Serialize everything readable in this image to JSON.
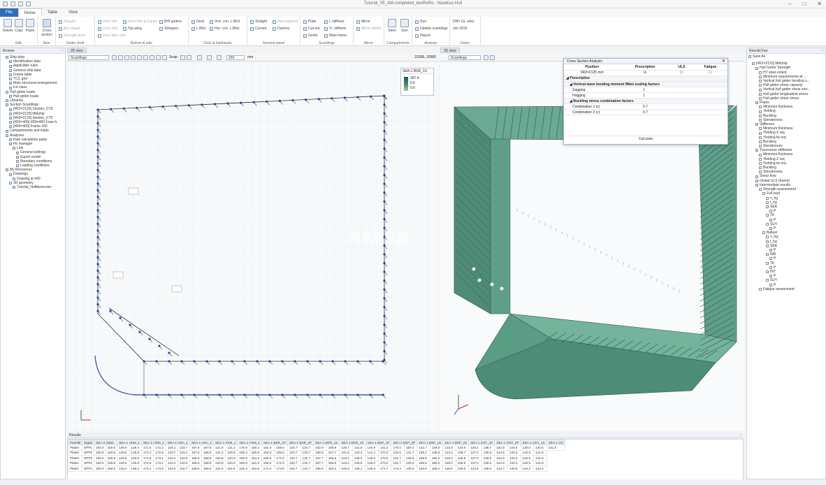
{
  "window": {
    "title": "Tutorial_05_AM.completed_testRoRo - Nauticus Hull"
  },
  "tabs": [
    "File",
    "Home",
    "Table",
    "View"
  ],
  "ribbon": {
    "edit_group": {
      "label": "Edit",
      "buttons": [
        "Delete",
        "Copy",
        "Paste"
      ]
    },
    "new_group": {
      "label": "New",
      "button": "Cross section"
    },
    "girder_shelf": {
      "label": "Girder shelf",
      "items": [
        "Straight",
        "Any shape",
        "Strength deck"
      ]
    },
    "bottom_side": {
      "label": "Bottom & side",
      "items": [
        "Inner btm",
        "Inner side",
        "Inner btm, side",
        "Inner btm & hopper",
        "Top wing",
        "BHI girders",
        "Stringers"
      ]
    },
    "deck_bulkheads": {
      "label": "Deck & bulkheads",
      "items": [
        "Deck",
        "L.Bhd.",
        "Vert. corr. L.Bhd.",
        "Hor. corr. L.Bhd."
      ]
    },
    "general_panel": {
      "label": "General panel",
      "items": [
        "Straight",
        "Curved",
        "Add segment",
        "Dummy"
      ]
    },
    "scantlings": {
      "label": "Scantlings",
      "items": [
        "Plate",
        "Cut-out",
        "Girder",
        "L.stiffener",
        "Tr. stiffener",
        "Main frame"
      ]
    },
    "mirror": {
      "label": "Mirror",
      "items": [
        "Mirror",
        "Mirror model"
      ]
    },
    "compartments": {
      "label": "Compartments",
      "items": [
        "Steel",
        "Gen"
      ]
    },
    "analysis": {
      "label": "Analysis",
      "items": [
        "Run",
        "Update scantlings",
        "Report"
      ]
    },
    "rules": {
      "label": "Rules",
      "items": [
        "DNV GL rules",
        "Jan 2016"
      ]
    }
  },
  "browse": {
    "title": "Browse",
    "items": [
      "Ship data",
      "Identification data",
      "Applicable rules",
      "General ship data",
      "Frame table",
      "TCC grid",
      "Main structural arrangement",
      "Ice class",
      "Hull girder loads",
      "Hull girder loads",
      "Libraries",
      "Section Scantlings",
      "[#R2=2125] Section_CTE",
      "[#R2=2125] Midship",
      "[#R0=2125] Section_CT5",
      "[#R0=400] #R0=400 Fram h.",
      "[#R0=400] Frame #60",
      "Compartments and loads",
      "Analyses",
      "Rule calculation tasks",
      "FE manager",
      "Link",
      "General settings",
      "Export model",
      "Boundary conditions",
      "Loading conditions",
      "My Resources",
      "Drawings",
      "Drawing at #60",
      "3D geometry",
      "Tutorial_Huffdemo.ber"
    ]
  },
  "view2d": {
    "tab": "Scantlings",
    "tab2": "2D view",
    "mode": "Scantlings",
    "snap": "Snap",
    "zoom": "150",
    "unit": "mm",
    "coords": "23285, 20580",
    "legend_title": "SEA-1 BSR_1S",
    "legend_values": [
      "187.4",
      "0.0",
      "0.0"
    ]
  },
  "view3d": {
    "tab": "3D view",
    "mode": "Scantlings"
  },
  "csa": {
    "title": "Cross Section Analysis",
    "col_headers": [
      "Position",
      "Prescriptive",
      "ULS",
      "Fatigue"
    ],
    "position": "#R2=2125 mm",
    "section_prescriptive": "Prescriptive",
    "sub1": "Vertical wave bending moment fMwv scaling factors",
    "rows1": [
      {
        "label": "Sagging",
        "value": "1"
      },
      {
        "label": "Hogging",
        "value": "1"
      }
    ],
    "sub2": "Buckling stress combination factors",
    "rows2": [
      {
        "label": "Combination 1 (c)",
        "value": "0.7"
      },
      {
        "label": "Combination 2 (c)",
        "value": "0.7"
      }
    ],
    "calculate": "Calculate"
  },
  "results_tree": {
    "title": "ResultsTree",
    "save_as": "Save As",
    "items": [
      "[#R2=2125] Midship",
      "Hull Girder Strength",
      "HT steel extent",
      "Minimum requirements at ...",
      "Vertical hull girder bending s...",
      "Hull girder shear capacity",
      "Vertical hull girder shear stre...",
      "Hull girder longitudinal stress",
      "Hull girder shear stress",
      "Plates",
      "Minimum thickness",
      "Yielding",
      "Buckling",
      "Slenderness",
      "Stiffeners",
      "Minimum thickness",
      "Yielding Z req",
      "Yielding tw req",
      "Buckling",
      "Slenderness",
      "Transverse stiffeners",
      "Minimum thickness",
      "Yielding Z req",
      "Yielding tw req",
      "Buckling",
      "Slenderness",
      "Shear flow",
      "Global ULS (frame)",
      "Intermediate results",
      "Strength assessment",
      "Full load",
      "n_hg",
      "t_hg",
      "SEA",
      "P",
      "TK",
      "P",
      "SLH",
      "P",
      "Ballast",
      "n_hg",
      "t_hg",
      "SEA",
      "P",
      "WB",
      "P",
      "TK",
      "P",
      "INT",
      "P",
      "SLH",
      "P",
      "Fatigue assessment"
    ]
  },
  "results": {
    "title": "Results",
    "headers": [
      "Panelld",
      "Eppid",
      "SEA-2 Static",
      "SEA-1 HSM_1",
      "SEA-1 HSM_2",
      "SEA-1 HSA_1",
      "SEA-1 HSA_2",
      "SEA-1 FSM_1",
      "SEA-1 FSM_2",
      "SEA-1 BSR_1P",
      "SEA-1 BSR_2P",
      "SEA-1 BSR_1S",
      "SEA-1 BSR_2S",
      "SEA-1 BSP_1P",
      "SEA-1 BSP_2P",
      "SEA-1 BSP_1S",
      "SEA-1 BSP_2S",
      "SEA-1 OST_1P",
      "SEA-1 OST_2P",
      "SEA-1 OST_1S",
      "SEA-1 OS"
    ],
    "rows": [
      [
        "Plate0",
        "EPP1",
        "150.0",
        "150.6",
        "129.6",
        "129.4",
        "171.6",
        "172.2",
        "134.1",
        "133.7",
        "167.6",
        "167.9",
        "121.8",
        "121.2",
        "176.8",
        "180.4",
        "162.0",
        "169.0",
        "126.7",
        "134.7",
        "162.9",
        "158.9",
        "138.7",
        "141.6",
        "140.9",
        "141.2",
        "170.0",
        "150.4",
        "131.7",
        "129.5",
        "133.5",
        "134.6",
        "129.2",
        "138.7",
        "162.5",
        "144.5",
        "129.0",
        "140.5",
        "141.0"
      ],
      [
        "Plate0",
        "EPP2",
        "150.0",
        "150.8",
        "129.6",
        "129.8",
        "172.2",
        "172.6",
        "133.7",
        "133.4",
        "167.8",
        "168.0",
        "121.3",
        "120.8",
        "180.4",
        "180.9",
        "162.3",
        "169.5",
        "134.7",
        "133.7",
        "158.9",
        "157.7",
        "141.6",
        "143.4",
        "141.2",
        "170.0",
        "134.6",
        "131.7",
        "135.1",
        "136.6",
        "134.0",
        "138.7",
        "137.0",
        "138.5",
        "144.6",
        "140.3",
        "140.9",
        "141.8"
      ],
      [
        "Plate0",
        "EPP3",
        "150.0",
        "150.9",
        "129.0",
        "128.9",
        "172.6",
        "173.1",
        "133.4",
        "133.0",
        "168.0",
        "168.6",
        "120.8",
        "120.3",
        "180.9",
        "181.3",
        "169.0",
        "171.0",
        "133.7",
        "132.7",
        "157.7",
        "155.6",
        "143.4",
        "146.0",
        "145.0",
        "170.0",
        "131.7",
        "129.0",
        "165.6",
        "166.2",
        "128.0",
        "135.5",
        "137.0",
        "139.0",
        "164.8",
        "140.3",
        "140.9",
        "141.8"
      ],
      [
        "Plate1",
        "EPP1",
        "150.0",
        "150.8",
        "129.5",
        "129.8",
        "172.6",
        "173.1",
        "133.4",
        "133.0",
        "168.0",
        "168.6",
        "120.8",
        "120.3",
        "180.9",
        "181.3",
        "169.0",
        "171.0",
        "133.7",
        "132.7",
        "157.7",
        "155.6",
        "143.4",
        "145.9",
        "145.0",
        "170.0",
        "131.7",
        "129.0",
        "165.6",
        "166.2",
        "128.0",
        "135.5",
        "137.0",
        "139.0",
        "164.8",
        "140.3",
        "140.9",
        "141.8"
      ],
      [
        "Plate1",
        "EPP4",
        "150.0",
        "150.6",
        "126.2",
        "126.2",
        "173.1",
        "173.5",
        "133.0",
        "132.7",
        "168.6",
        "169.0",
        "120.3",
        "119.6",
        "181.3",
        "181.6",
        "171.0",
        "173.6",
        "132.7",
        "131.7",
        "155.6",
        "153.2",
        "145.8",
        "148.1",
        "146.6",
        "171.7",
        "174.4",
        "129.0",
        "126.5",
        "166.2",
        "136.6",
        "128.0",
        "124.5",
        "139.0",
        "143.7",
        "140.9",
        "143.2",
        "143.2"
      ]
    ]
  },
  "watermark": {
    "text": "河东软件园",
    "sub": "www.orsoon.com"
  },
  "colors": {
    "accent": "#2f6fb3",
    "hull": "#5f9e8a",
    "hull_dark": "#2f5a4c",
    "blue_nodes": "#2846b8"
  }
}
